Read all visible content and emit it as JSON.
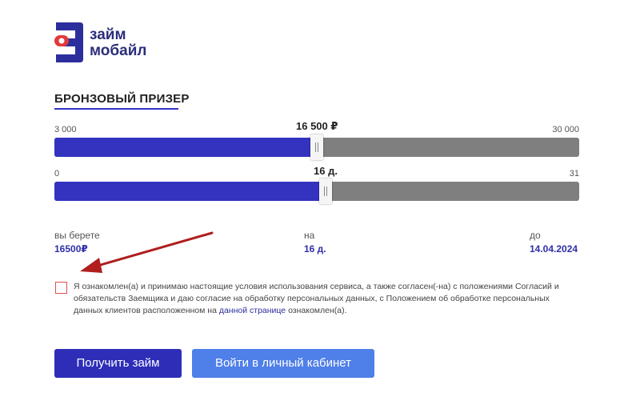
{
  "brand": {
    "line1": "займ",
    "line2": "мобайл"
  },
  "product_title": "БРОНЗОВЫЙ ПРИЗЕР",
  "amount_slider": {
    "min_label": "3 000",
    "max_label": "30 000",
    "value_label": "16 500 ₽",
    "value": 16500,
    "min": 3000,
    "max": 30000
  },
  "days_slider": {
    "min_label": "0",
    "max_label": "31",
    "value_label": "16 д.",
    "value": 16,
    "min": 0,
    "max": 31
  },
  "summary": {
    "take_label": "вы берете",
    "take_value": "16500₽",
    "term_label": "на",
    "term_value": "16 д.",
    "until_label": "до",
    "until_value": "14.04.2024"
  },
  "consent": {
    "text_before": "Я ознакомлен(а) и принимаю настоящие условия использования сервиса, а также согласен(-на) с положениями Согласий и обязательств Заемщика и даю согласие на обработку персональных данных, с Положением об обработке персональных данных клиентов расположенном на ",
    "link_text": "данной странице",
    "text_after": " ознакомлен(а).",
    "checked": false
  },
  "buttons": {
    "get_loan": "Получить займ",
    "login": "Войти в личный кабинет"
  },
  "colors": {
    "accent": "#3333c0",
    "track": "#7f7f7f",
    "secondary_button": "#4f7fe8",
    "arrow": "#b01e1e"
  }
}
